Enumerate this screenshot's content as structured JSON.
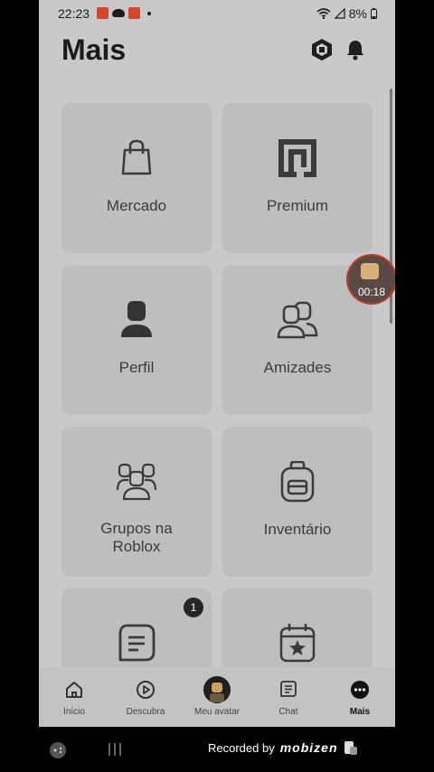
{
  "status_bar": {
    "time": "22:23",
    "battery": "8%"
  },
  "header": {
    "title": "Mais",
    "robux_icon": "robux-hexagon-icon",
    "notifications_icon": "bell-icon"
  },
  "tiles": [
    {
      "label": "Mercado",
      "icon": "shopping-bag-icon"
    },
    {
      "label": "Premium",
      "icon": "premium-icon"
    },
    {
      "label": "Perfil",
      "icon": "person-icon"
    },
    {
      "label": "Amizades",
      "icon": "friends-icon"
    },
    {
      "label": "Grupos na Roblox",
      "icon": "groups-icon"
    },
    {
      "label": "Inventário",
      "icon": "backpack-icon"
    },
    {
      "label": "",
      "icon": "messages-icon",
      "badge": "1"
    },
    {
      "label": "",
      "icon": "calendar-star-icon"
    }
  ],
  "recording_bubble": {
    "timer": "00:18"
  },
  "tab_bar": {
    "tabs": [
      {
        "label": "Início",
        "icon": "home-icon"
      },
      {
        "label": "Descubra",
        "icon": "play-circle-icon"
      },
      {
        "label": "Meu avatar",
        "icon": "avatar-icon"
      },
      {
        "label": "Chat",
        "icon": "chat-icon"
      },
      {
        "label": "Mais",
        "icon": "more-icon",
        "active": true
      }
    ]
  },
  "recorder_watermark": {
    "text": "Recorded by",
    "brand": "mobizen"
  }
}
